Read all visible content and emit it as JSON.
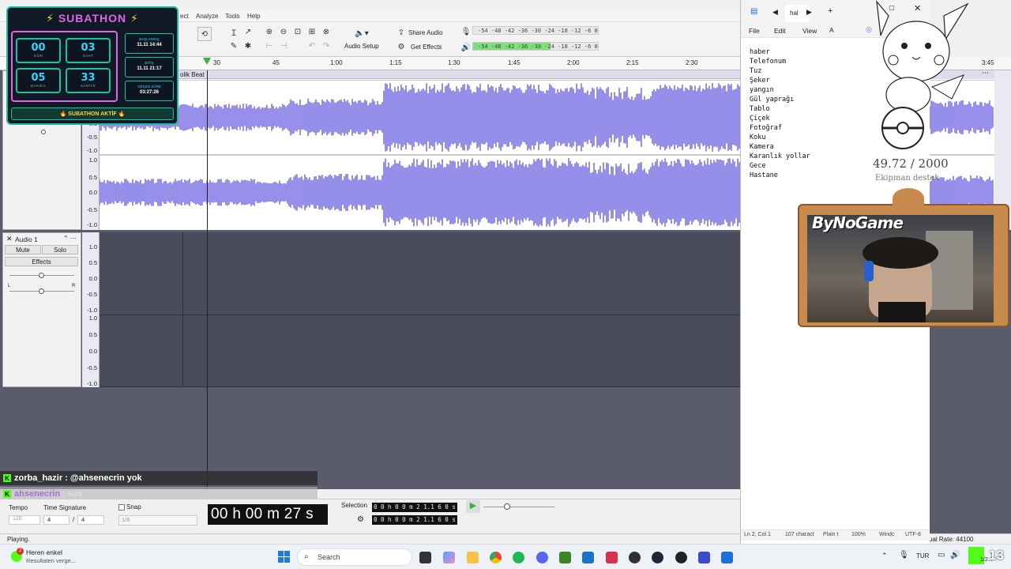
{
  "menu": {
    "effect_tail": "ect",
    "analyze": "Analyze",
    "tools": "Tools",
    "help": "Help"
  },
  "toolbar": {
    "audio_setup": "Audio Setup",
    "share_audio": "Share Audio",
    "get_effects": "Get Effects",
    "meter_ticks_rec": [
      "-54",
      "-48",
      "-42",
      "-36",
      "-30",
      "-24",
      "-18",
      "-12",
      "-6",
      "0"
    ],
    "meter_ticks_play": [
      "-54",
      "-48",
      "-42",
      "-36",
      "-30",
      "-24",
      "-18",
      "-12",
      "-6",
      "0"
    ]
  },
  "ruler": {
    "ticks": [
      "30",
      "45",
      "1:00",
      "1:15",
      "1:30",
      "1:45",
      "2:00",
      "2:15",
      "2:30",
      "3:45"
    ]
  },
  "track1": {
    "name_tail": "olik Beat"
  },
  "track2": {
    "name": "Audio 1",
    "mute": "Mute",
    "solo": "Solo",
    "effects": "Effects",
    "pan_l": "L",
    "pan_r": "R"
  },
  "yscale": {
    "labels": [
      "1.0",
      "0.5",
      "0.0",
      "-0.5",
      "-1.0"
    ],
    "labels_top": [
      "-1.0",
      "1.0",
      "0.5",
      "0.0",
      "-0.5",
      "-1.0"
    ]
  },
  "chat": [
    {
      "user": "zorba_hazir",
      "text": ": @ahsenecrin yok"
    },
    {
      "user": "ahsenecrin",
      "text": ": sus"
    }
  ],
  "bottom": {
    "tempo_label": "Tempo",
    "tempo_value": "120",
    "timesig_label": "Time Signature",
    "timesig_num": "4",
    "timesig_slash": "/",
    "timesig_den": "4",
    "snap_label": "Snap",
    "snap_value": "1/8",
    "time_display": "00 h 00 m 27 s",
    "selection_label": "Selection",
    "sel_start": "0 0 h 0 0 m 2 1.1 6 0 s",
    "sel_end": "0 0 h 0 0 m 2 1.1 6 0 s"
  },
  "status": {
    "playing": "Playing.",
    "rate": "ual Rate: 44100"
  },
  "notepad": {
    "tab_title": "hal",
    "menu": [
      "File",
      "Edit",
      "View"
    ],
    "lines": [
      "haber",
      "Telefonum",
      "Tuz",
      "Şeker",
      "yangın",
      "Gül yaprağı",
      "Tablo",
      "Çiçek",
      "Fotoğraf",
      "Koku",
      "Kamera",
      "Karanlık yollar",
      "Gece",
      "Hastane"
    ],
    "status": {
      "pos": "Ln 2, Col 1",
      "chars": "107 charact",
      "enc1": "Plain t",
      "zoom": "100%",
      "eol": "Windc",
      "enc": "UTF-8"
    }
  },
  "overlay": {
    "donation": "49.72 / 2000",
    "donation_sub": "Ekipman destek"
  },
  "webcam": {
    "title": "ByNoGame"
  },
  "subathon": {
    "title": "SUBATHON",
    "counters": [
      {
        "value": "00",
        "label": "GÜN"
      },
      {
        "value": "03",
        "label": "SAAT"
      },
      {
        "value": "05",
        "label": "DAKİKA"
      },
      {
        "value": "33",
        "label": "SANİYE"
      }
    ],
    "info": [
      {
        "label": "BAŞLANGIÇ",
        "value": "11.11 14:44"
      },
      {
        "label": "BİTİŞ",
        "value": "11.11 21:17"
      },
      {
        "label": "GEÇEN SÜRE",
        "value": "03:27:26"
      }
    ],
    "status": "SUBATHON AKTİF"
  },
  "taskbar": {
    "notif_title": "Heren enkel",
    "notif_sub": "Resultaten verge...",
    "notif_count": "2",
    "search": "Search",
    "lang": "TUR",
    "clock": "1/2...",
    "tray_num": "13"
  },
  "colors": {
    "wave": "#6a5fe0",
    "accent_teal": "#19c2a6",
    "meter_green": "#7de07a",
    "kick_green": "#53fc18"
  }
}
